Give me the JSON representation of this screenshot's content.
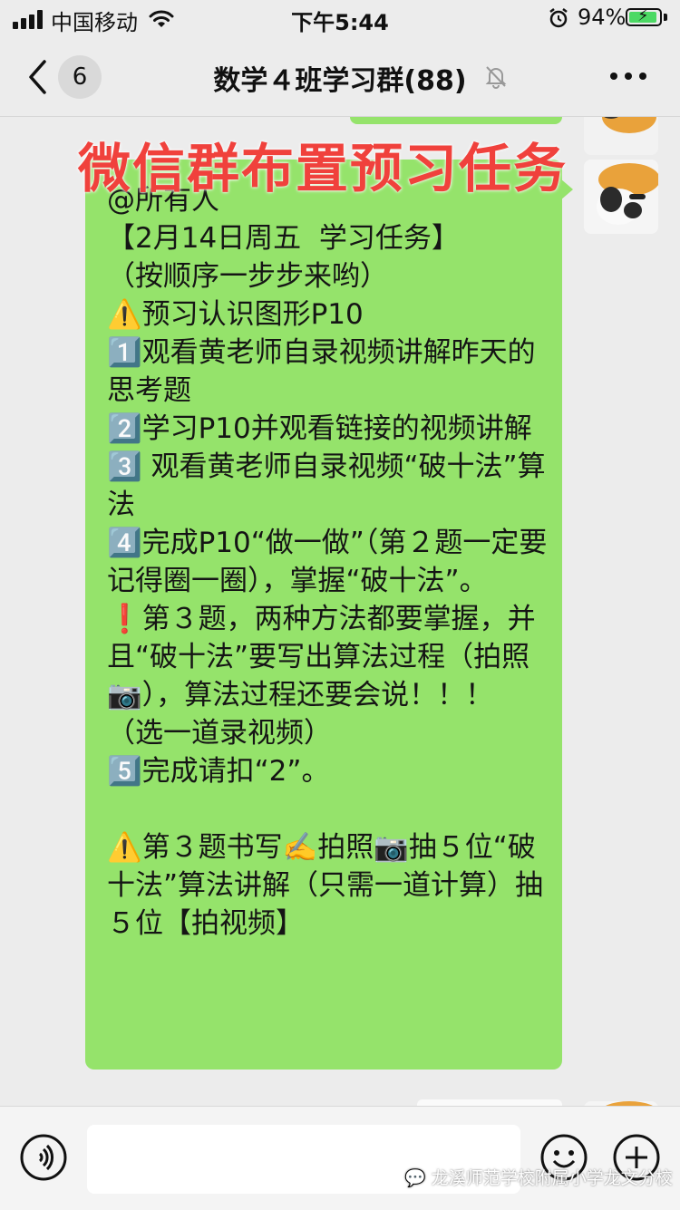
{
  "status_bar": {
    "carrier": "中国移动",
    "time": "下午5:44",
    "battery_percent": "94%",
    "battery_level": 0.94,
    "battery_color": "#4cd964"
  },
  "nav": {
    "back_icon": "chevron-left-icon",
    "unread_count": "6",
    "title": "数学４班学习群(88)",
    "mute_icon": "bell-slash-icon",
    "more_icon": "ellipsis-icon"
  },
  "chat": {
    "bubble_color": "#95e36b",
    "overlay_caption": "微信群布置预习任务",
    "message": "@所有人\n【2月14日周五  学习任务】\n（按顺序一步步来哟）\n⚠️预习认识图形P10\n1️⃣观看黄老师自录视频讲解昨天的思考题\n2️⃣学习P10并观看链接的视频讲解\n3️⃣ 观看黄老师自录视频“破十法”算法\n4️⃣完成P10“做一做”（第２题一定要记得圈一圈），掌握“破十法”。\n❗️第３题，两种方法都要掌握，并且“破十法”要写出算法过程（拍照📷），算法过程还要会说！！！ （选一道录视频）\n5️⃣完成请扣“2”。\n\n⚠️第３题书写✍️拍照📷抽５位“破十法”算法讲解（只需一道计算）抽５位【拍视频】"
  },
  "input_bar": {
    "input_value": "",
    "voice_icon": "voice-icon",
    "emoji_icon": "emoji-icon",
    "plus_icon": "plus-icon"
  },
  "watermark": {
    "text": "龙溪师范学校附属小学龙文分校",
    "icon": "wechat-icon"
  }
}
